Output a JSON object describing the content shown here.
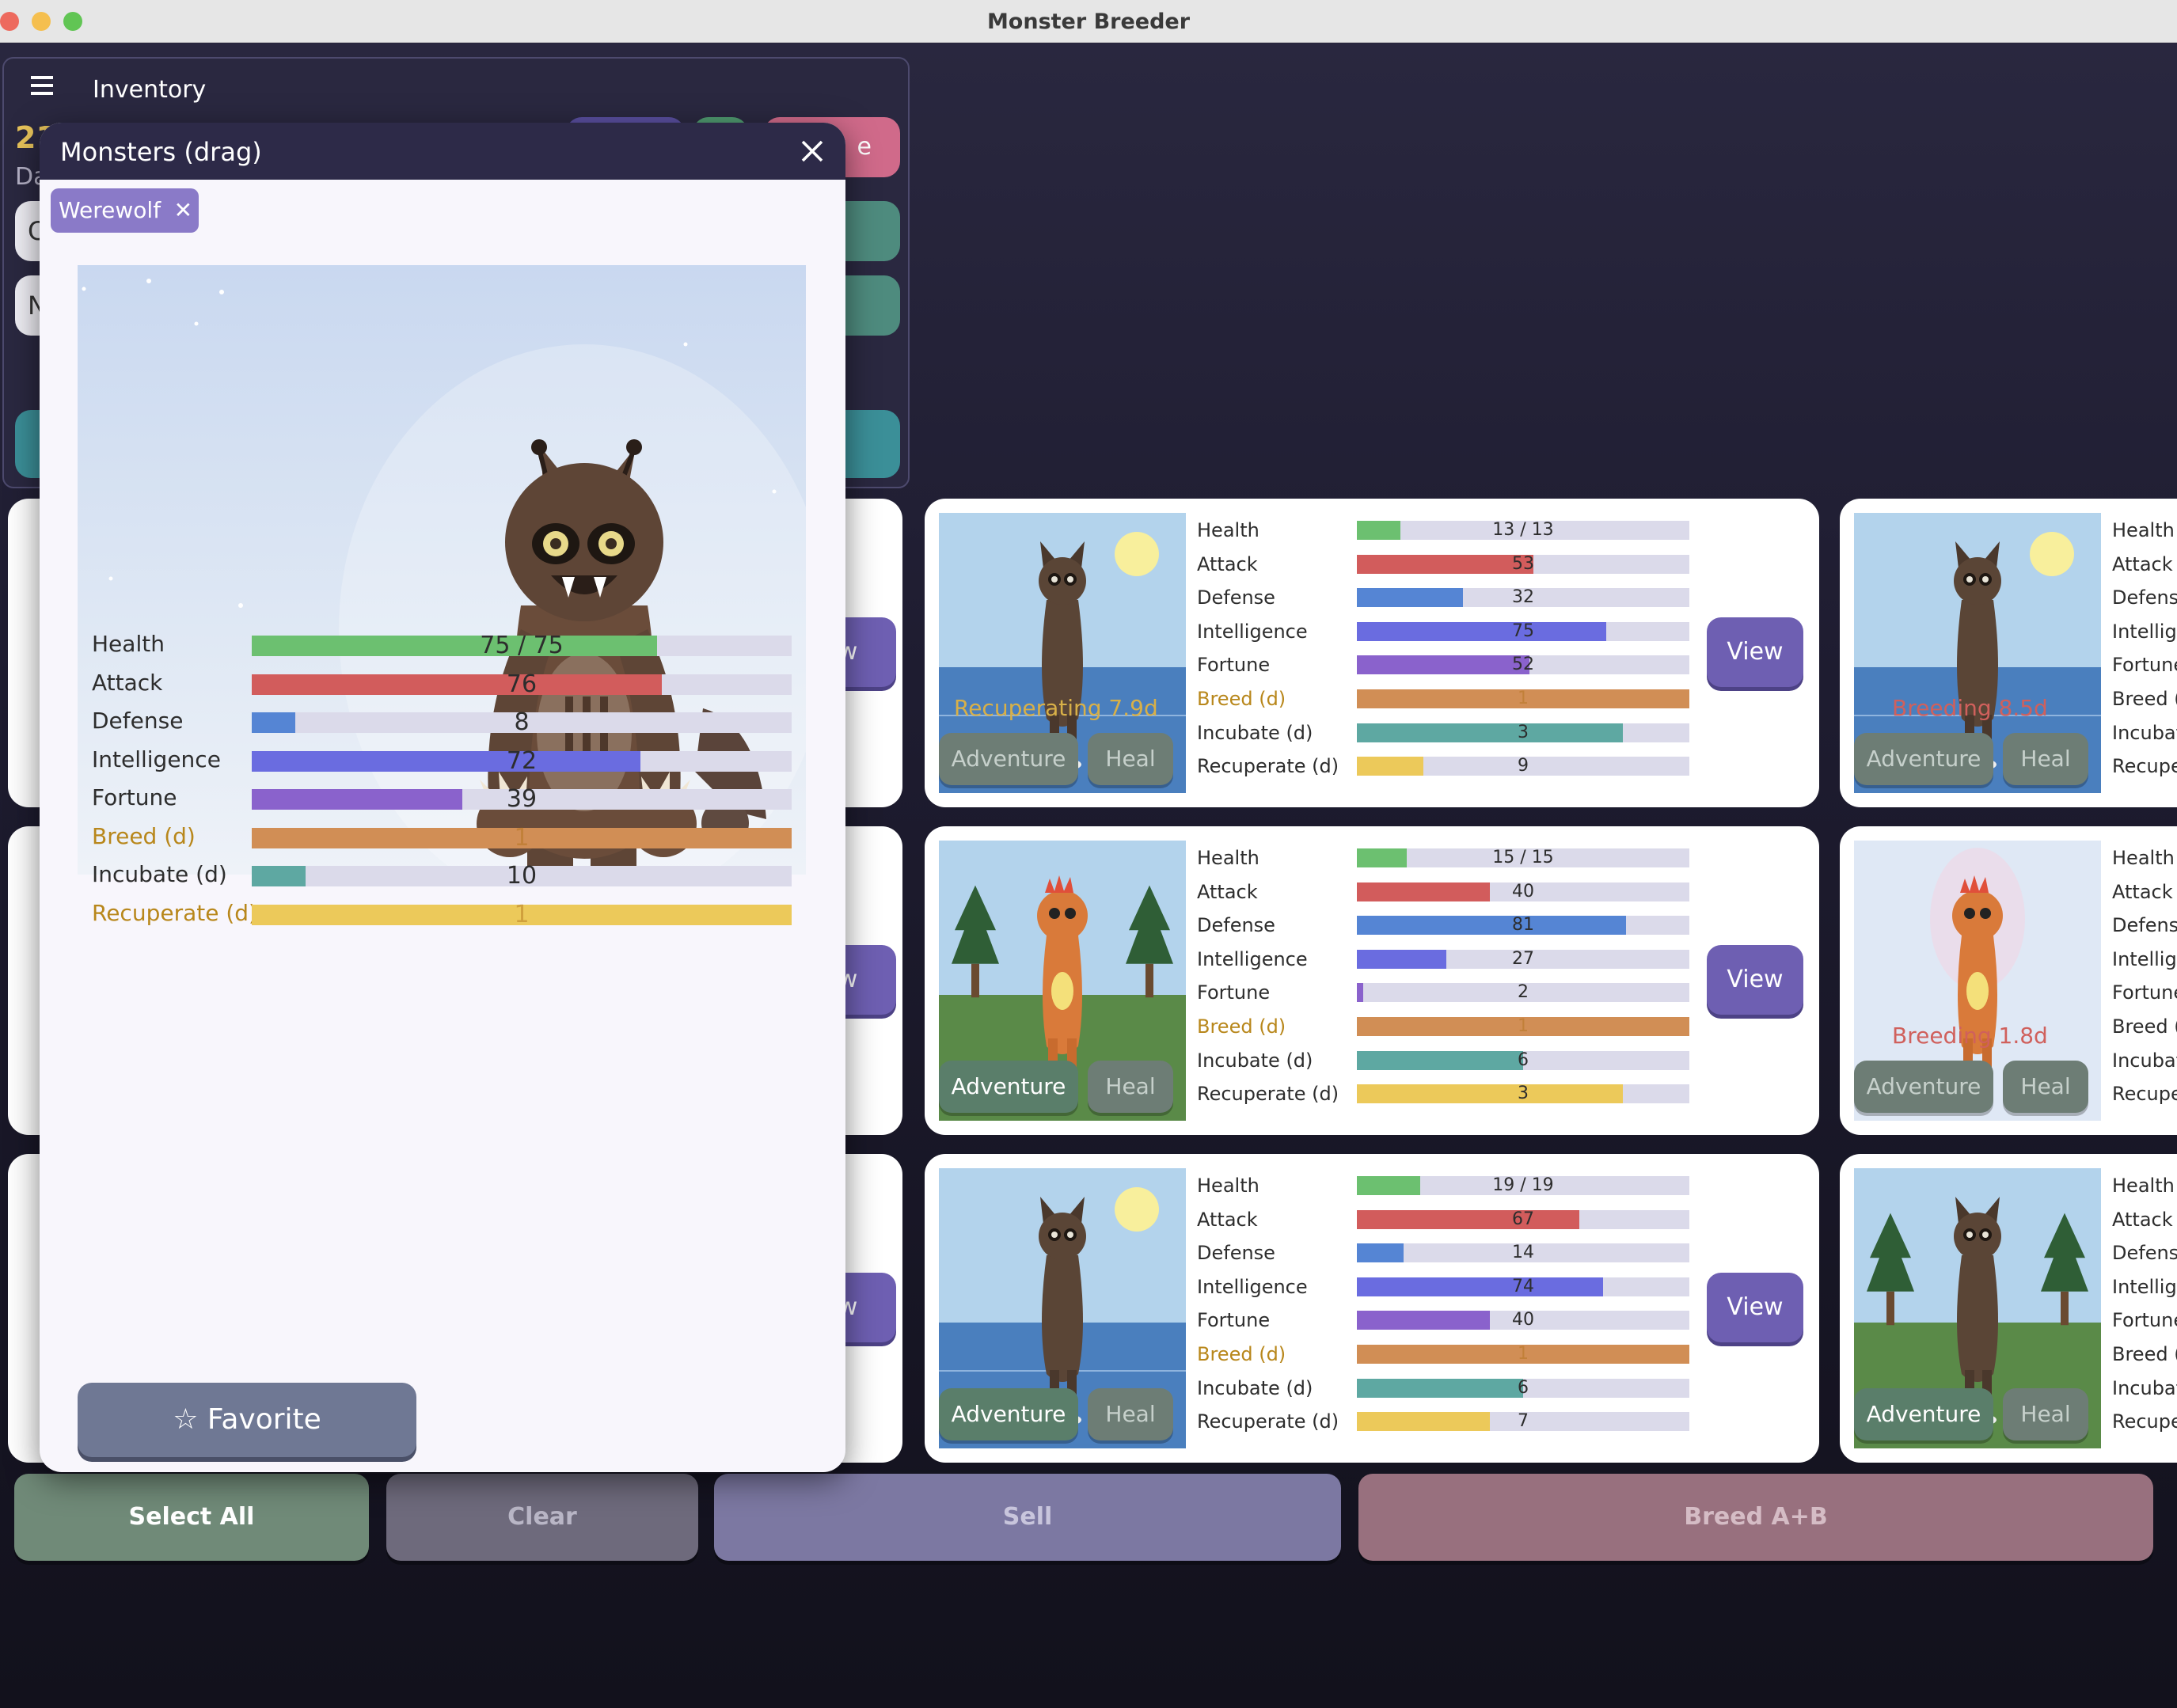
{
  "window": {
    "title": "Monster Breeder"
  },
  "inventory": {
    "title": "Inventory",
    "gold_partial": "21",
    "day_partial": "Da",
    "field1_partial": "C",
    "field2_partial": "N",
    "btn_partial": "e"
  },
  "modal": {
    "title": "Monsters  (drag)",
    "chip": "Werewolf",
    "stats": [
      {
        "label": "Health",
        "value": "75 / 75",
        "fill": 0.75,
        "color": "#6cc070",
        "gold": false
      },
      {
        "label": "Attack",
        "value": "76",
        "fill": 0.76,
        "color": "#d25c5c",
        "gold": false
      },
      {
        "label": "Defense",
        "value": "8",
        "fill": 0.08,
        "color": "#5585d4",
        "gold": false
      },
      {
        "label": "Intelligence",
        "value": "72",
        "fill": 0.72,
        "color": "#6a6ce0",
        "gold": false
      },
      {
        "label": "Fortune",
        "value": "39",
        "fill": 0.39,
        "color": "#8a62cc",
        "gold": false
      },
      {
        "label": "Breed (d)",
        "value": "1",
        "fill": 1.0,
        "color": "#d18e55",
        "gold": true
      },
      {
        "label": "Incubate (d)",
        "value": "10",
        "fill": 0.1,
        "color": "#5ea8a2",
        "gold": false
      },
      {
        "label": "Recuperate (d)",
        "value": "1",
        "fill": 1.0,
        "color": "#ecc95a",
        "gold": true
      }
    ],
    "favorite": "☆ Favorite"
  },
  "cards": [
    {
      "status": "Recuperating  7.9d",
      "status_color": "#d8b048",
      "scene": "water",
      "stats": [
        {
          "label": "Health",
          "value": "13 / 13",
          "fill": 0.13,
          "color": "#6cc070",
          "gold": false
        },
        {
          "label": "Attack",
          "value": "53",
          "fill": 0.53,
          "color": "#d25c5c",
          "gold": false
        },
        {
          "label": "Defense",
          "value": "32",
          "fill": 0.32,
          "color": "#5585d4",
          "gold": false
        },
        {
          "label": "Intelligence",
          "value": "75",
          "fill": 0.75,
          "color": "#6a6ce0",
          "gold": false
        },
        {
          "label": "Fortune",
          "value": "52",
          "fill": 0.52,
          "color": "#8a62cc",
          "gold": false
        },
        {
          "label": "Breed (d)",
          "value": "1",
          "fill": 1.0,
          "color": "#d18e55",
          "gold": true
        },
        {
          "label": "Incubate (d)",
          "value": "3",
          "fill": 0.8,
          "color": "#5ea8a2",
          "gold": false
        },
        {
          "label": "Recuperate (d)",
          "value": "9",
          "fill": 0.2,
          "color": "#ecc95a",
          "gold": false
        }
      ],
      "adventure": "Adventure",
      "heal": "Heal",
      "view": "View",
      "adventure_active": false
    },
    {
      "status": "",
      "status_color": "#d8b048",
      "scene": "trees",
      "stats": [
        {
          "label": "Health",
          "value": "15 / 15",
          "fill": 0.15,
          "color": "#6cc070",
          "gold": false
        },
        {
          "label": "Attack",
          "value": "40",
          "fill": 0.4,
          "color": "#d25c5c",
          "gold": false
        },
        {
          "label": "Defense",
          "value": "81",
          "fill": 0.81,
          "color": "#5585d4",
          "gold": false
        },
        {
          "label": "Intelligence",
          "value": "27",
          "fill": 0.27,
          "color": "#6a6ce0",
          "gold": false
        },
        {
          "label": "Fortune",
          "value": "2",
          "fill": 0.02,
          "color": "#8a62cc",
          "gold": false
        },
        {
          "label": "Breed (d)",
          "value": "1",
          "fill": 1.0,
          "color": "#d18e55",
          "gold": true
        },
        {
          "label": "Incubate (d)",
          "value": "6",
          "fill": 0.5,
          "color": "#5ea8a2",
          "gold": false
        },
        {
          "label": "Recuperate (d)",
          "value": "3",
          "fill": 0.8,
          "color": "#ecc95a",
          "gold": false
        }
      ],
      "adventure": "Adventure",
      "heal": "Heal",
      "view": "View",
      "adventure_active": true
    },
    {
      "status": "",
      "status_color": "#d8b048",
      "scene": "water",
      "stats": [
        {
          "label": "Health",
          "value": "19 / 19",
          "fill": 0.19,
          "color": "#6cc070",
          "gold": false
        },
        {
          "label": "Attack",
          "value": "67",
          "fill": 0.67,
          "color": "#d25c5c",
          "gold": false
        },
        {
          "label": "Defense",
          "value": "14",
          "fill": 0.14,
          "color": "#5585d4",
          "gold": false
        },
        {
          "label": "Intelligence",
          "value": "74",
          "fill": 0.74,
          "color": "#6a6ce0",
          "gold": false
        },
        {
          "label": "Fortune",
          "value": "40",
          "fill": 0.4,
          "color": "#8a62cc",
          "gold": false
        },
        {
          "label": "Breed (d)",
          "value": "1",
          "fill": 1.0,
          "color": "#d18e55",
          "gold": true
        },
        {
          "label": "Incubate (d)",
          "value": "6",
          "fill": 0.5,
          "color": "#5ea8a2",
          "gold": false
        },
        {
          "label": "Recuperate (d)",
          "value": "7",
          "fill": 0.4,
          "color": "#ecc95a",
          "gold": false
        }
      ],
      "adventure": "Adventure",
      "heal": "Heal",
      "view": "View",
      "adventure_active": true
    }
  ],
  "right_cards": [
    {
      "status": "Breeding  8.5d",
      "status_color": "#d0605c",
      "scene": "water",
      "adventure": "Adventure",
      "heal": "Heal",
      "labels": [
        "Health",
        "Attack",
        "Defens",
        "Intellige",
        "Fortune",
        "Breed (",
        "Incubat",
        "Recupe"
      ]
    },
    {
      "status": "Breeding  1.8d",
      "status_color": "#d0605c",
      "scene": "plain",
      "adventure": "Adventure",
      "heal": "Heal",
      "labels": [
        "Health",
        "Attack",
        "Defens",
        "Intellige",
        "Fortune",
        "Breed (d",
        "Incubat",
        "Recupe"
      ]
    },
    {
      "status": "",
      "status_color": "#d0605c",
      "scene": "trees",
      "adventure": "Adventure",
      "heal": "Heal",
      "labels": [
        "Health",
        "Attack",
        "Defens",
        "Intellige",
        "Fortune",
        "Breed (",
        "Incubat",
        "Recupe"
      ]
    }
  ],
  "left_partial_view": "w",
  "bottom": {
    "select_all": "Select All",
    "clear": "Clear",
    "sell": "Sell",
    "breed": "Breed A+B"
  }
}
